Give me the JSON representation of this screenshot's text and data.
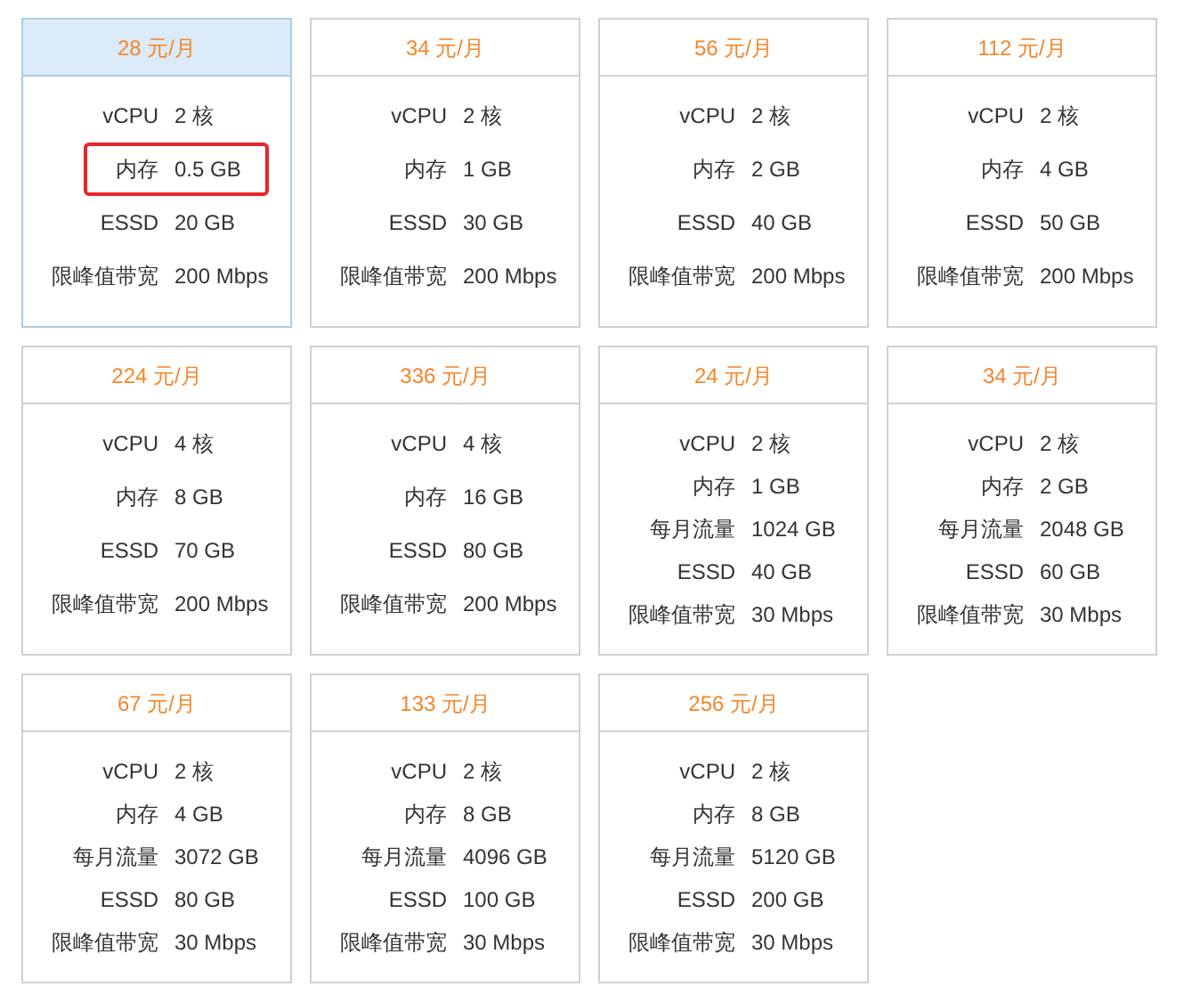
{
  "plans": [
    {
      "price": "28 元/月",
      "selected": true,
      "specs": [
        {
          "label": "vCPU",
          "value": "2 核",
          "highlighted": false
        },
        {
          "label": "内存",
          "value": "0.5 GB",
          "highlighted": true
        },
        {
          "label": "ESSD",
          "value": "20 GB",
          "highlighted": false
        },
        {
          "label": "限峰值带宽",
          "value": "200 Mbps",
          "highlighted": false
        }
      ]
    },
    {
      "price": "34 元/月",
      "selected": false,
      "specs": [
        {
          "label": "vCPU",
          "value": "2 核",
          "highlighted": false
        },
        {
          "label": "内存",
          "value": "1 GB",
          "highlighted": false
        },
        {
          "label": "ESSD",
          "value": "30 GB",
          "highlighted": false
        },
        {
          "label": "限峰值带宽",
          "value": "200 Mbps",
          "highlighted": false
        }
      ]
    },
    {
      "price": "56 元/月",
      "selected": false,
      "specs": [
        {
          "label": "vCPU",
          "value": "2 核",
          "highlighted": false
        },
        {
          "label": "内存",
          "value": "2 GB",
          "highlighted": false
        },
        {
          "label": "ESSD",
          "value": "40 GB",
          "highlighted": false
        },
        {
          "label": "限峰值带宽",
          "value": "200 Mbps",
          "highlighted": false
        }
      ]
    },
    {
      "price": "112 元/月",
      "selected": false,
      "specs": [
        {
          "label": "vCPU",
          "value": "2 核",
          "highlighted": false
        },
        {
          "label": "内存",
          "value": "4 GB",
          "highlighted": false
        },
        {
          "label": "ESSD",
          "value": "50 GB",
          "highlighted": false
        },
        {
          "label": "限峰值带宽",
          "value": "200 Mbps",
          "highlighted": false
        }
      ]
    },
    {
      "price": "224 元/月",
      "selected": false,
      "specs": [
        {
          "label": "vCPU",
          "value": "4 核",
          "highlighted": false
        },
        {
          "label": "内存",
          "value": "8 GB",
          "highlighted": false
        },
        {
          "label": "ESSD",
          "value": "70 GB",
          "highlighted": false
        },
        {
          "label": "限峰值带宽",
          "value": "200 Mbps",
          "highlighted": false
        }
      ]
    },
    {
      "price": "336 元/月",
      "selected": false,
      "specs": [
        {
          "label": "vCPU",
          "value": "4 核",
          "highlighted": false
        },
        {
          "label": "内存",
          "value": "16 GB",
          "highlighted": false
        },
        {
          "label": "ESSD",
          "value": "80 GB",
          "highlighted": false
        },
        {
          "label": "限峰值带宽",
          "value": "200 Mbps",
          "highlighted": false
        }
      ]
    },
    {
      "price": "24 元/月",
      "selected": false,
      "specs": [
        {
          "label": "vCPU",
          "value": "2 核",
          "highlighted": false
        },
        {
          "label": "内存",
          "value": "1 GB",
          "highlighted": false
        },
        {
          "label": "每月流量",
          "value": "1024 GB",
          "highlighted": false
        },
        {
          "label": "ESSD",
          "value": "40 GB",
          "highlighted": false
        },
        {
          "label": "限峰值带宽",
          "value": "30 Mbps",
          "highlighted": false
        }
      ]
    },
    {
      "price": "34 元/月",
      "selected": false,
      "specs": [
        {
          "label": "vCPU",
          "value": "2 核",
          "highlighted": false
        },
        {
          "label": "内存",
          "value": "2 GB",
          "highlighted": false
        },
        {
          "label": "每月流量",
          "value": "2048 GB",
          "highlighted": false
        },
        {
          "label": "ESSD",
          "value": "60 GB",
          "highlighted": false
        },
        {
          "label": "限峰值带宽",
          "value": "30 Mbps",
          "highlighted": false
        }
      ]
    },
    {
      "price": "67 元/月",
      "selected": false,
      "specs": [
        {
          "label": "vCPU",
          "value": "2 核",
          "highlighted": false
        },
        {
          "label": "内存",
          "value": "4 GB",
          "highlighted": false
        },
        {
          "label": "每月流量",
          "value": "3072 GB",
          "highlighted": false
        },
        {
          "label": "ESSD",
          "value": "80 GB",
          "highlighted": false
        },
        {
          "label": "限峰值带宽",
          "value": "30 Mbps",
          "highlighted": false
        }
      ]
    },
    {
      "price": "133 元/月",
      "selected": false,
      "specs": [
        {
          "label": "vCPU",
          "value": "2 核",
          "highlighted": false
        },
        {
          "label": "内存",
          "value": "8 GB",
          "highlighted": false
        },
        {
          "label": "每月流量",
          "value": "4096 GB",
          "highlighted": false
        },
        {
          "label": "ESSD",
          "value": "100 GB",
          "highlighted": false
        },
        {
          "label": "限峰值带宽",
          "value": "30 Mbps",
          "highlighted": false
        }
      ]
    },
    {
      "price": "256 元/月",
      "selected": false,
      "specs": [
        {
          "label": "vCPU",
          "value": "2 核",
          "highlighted": false
        },
        {
          "label": "内存",
          "value": "8 GB",
          "highlighted": false
        },
        {
          "label": "每月流量",
          "value": "5120 GB",
          "highlighted": false
        },
        {
          "label": "ESSD",
          "value": "200 GB",
          "highlighted": false
        },
        {
          "label": "限峰值带宽",
          "value": "30 Mbps",
          "highlighted": false
        }
      ]
    }
  ]
}
